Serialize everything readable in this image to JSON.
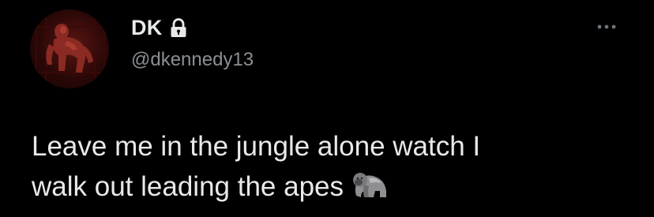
{
  "tweet": {
    "author": {
      "display_name": "DK",
      "handle": "@dkennedy13",
      "protected_icon": "lock-icon",
      "avatar_icon": "profile-photo"
    },
    "more_icon": "more-horizontal-icon",
    "text_line_1": "Leave me in the jungle alone watch I",
    "text_line_2": "walk out leading the apes",
    "emoji": "gorilla-emoji",
    "colors": {
      "background": "#000000",
      "primary_text": "#e7e9ea",
      "secondary_text": "#8b8f94"
    }
  }
}
